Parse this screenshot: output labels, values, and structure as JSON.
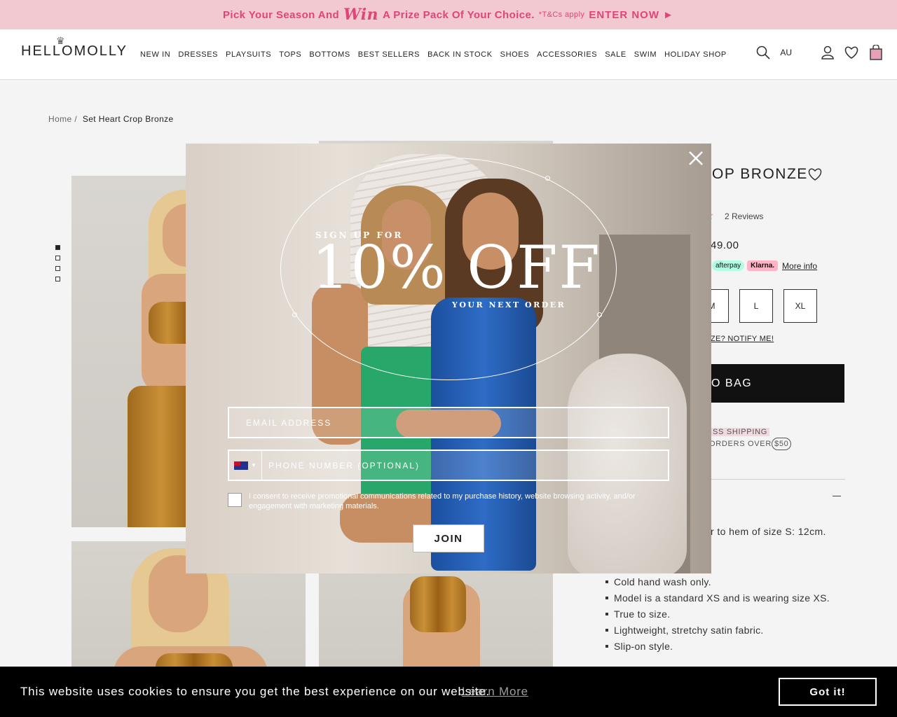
{
  "promo": {
    "text_before": "Pick Your Season And",
    "win": "Win",
    "text_after": "A Prize Pack Of Your Choice.",
    "tcs": "*T&Cs apply",
    "cta": "ENTER NOW ►"
  },
  "header": {
    "logo": "HELLOMOLLY",
    "nav": [
      "NEW IN",
      "DRESSES",
      "PLAYSUITS",
      "TOPS",
      "BOTTOMS",
      "BEST SELLERS",
      "BACK IN STOCK",
      "SHOES",
      "ACCESSORIES",
      "SALE",
      "SWIM",
      "HOLIDAY SHOP"
    ],
    "region": "AU"
  },
  "breadcrumb": {
    "home": "Home",
    "sep": "/",
    "current": "Set Heart Crop Bronze"
  },
  "product": {
    "title_visible": "OP BRONZE",
    "reviews": "2 Reviews",
    "price_visible": "49.00",
    "afterpay": "afterpay",
    "klarna": "Klarna.",
    "more_info": "More info",
    "sizes_visible": [
      "M",
      "L",
      "XL"
    ],
    "notify": "ZE? NOTIFY ME!",
    "add_to_bag_visible": "O BAG",
    "shipping_1": "SS SHIPPING",
    "shipping_2": "ORDERS OVER",
    "shipping_amount": "$50",
    "detail_first": "r to hem of size S: 12cm.",
    "details": [
      "Cold hand wash only.",
      "Model is a standard XS and is wearing size XS.",
      "True to size.",
      "Lightweight, stretchy satin fabric.",
      "Slip-on style."
    ]
  },
  "modal": {
    "signup": "SIGN UP FOR",
    "headline": "10% OFF",
    "subline": "YOUR NEXT ORDER",
    "email_placeholder": "EMAIL ADDRESS",
    "phone_placeholder": "PHONE NUMBER (OPTIONAL)",
    "consent": "I consent to receive promotional communications related to my purchase history, website browsing activity, and/or engagement with marketing materials.",
    "join": "JOIN"
  },
  "cookie": {
    "message": "This website uses cookies to ensure you get the best experience on our website.",
    "learn_more": "Learn More",
    "accept": "Got it!"
  },
  "colors": {
    "promo_bg": "#f2c8d1",
    "promo_text": "#e0457a",
    "dress_green": "#27a86a",
    "dress_blue": "#2e6cc6",
    "satin_bronze": "#c99037"
  }
}
